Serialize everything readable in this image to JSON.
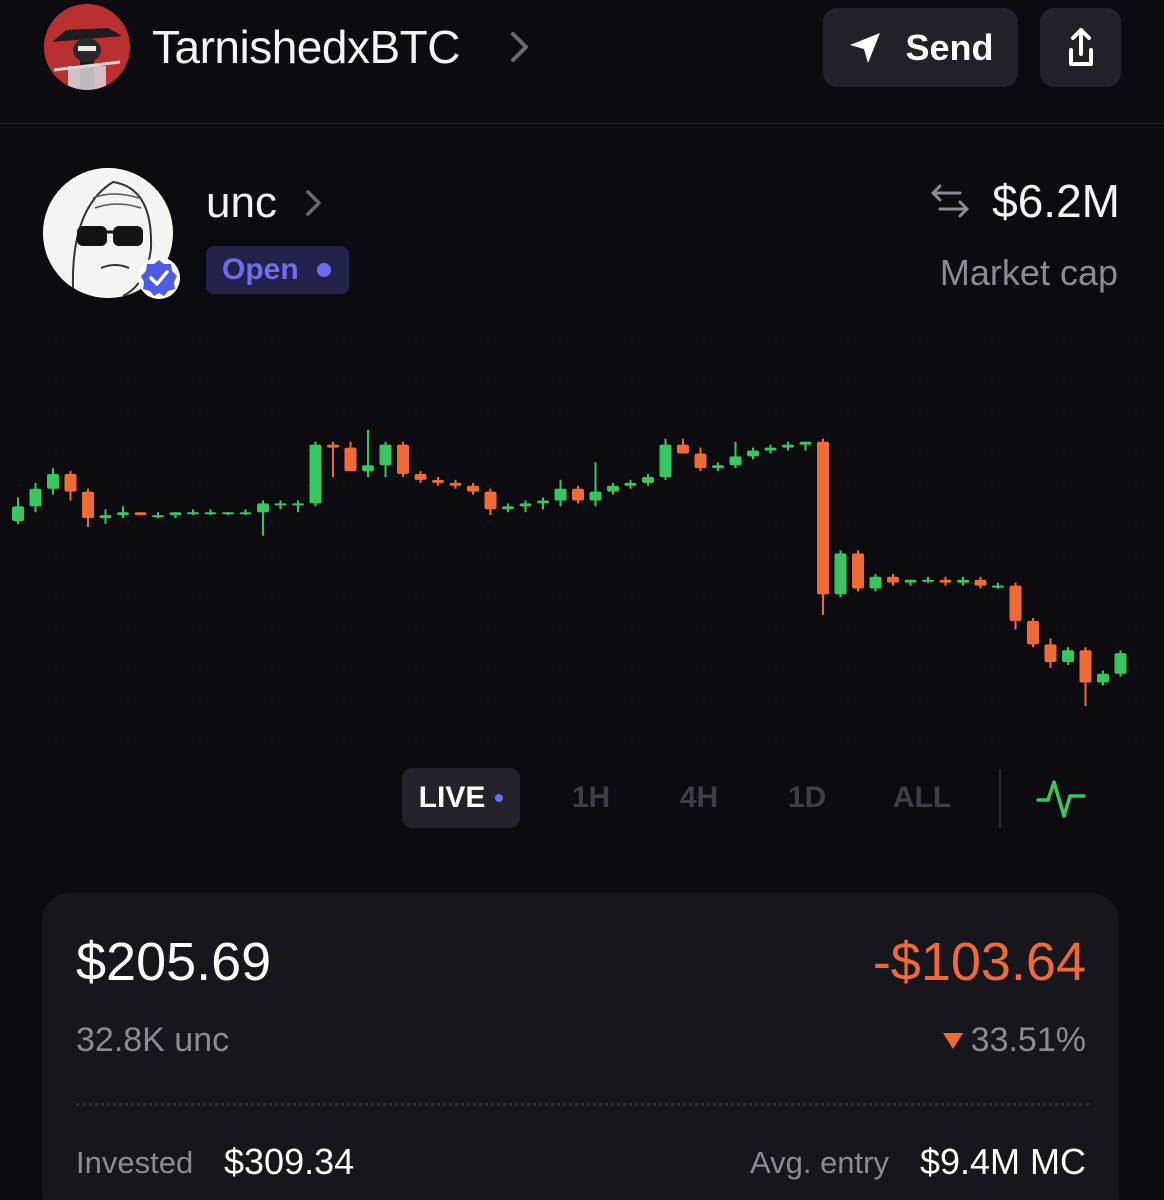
{
  "header": {
    "user_name": "TarnishedxBTC",
    "send_label": "Send"
  },
  "token": {
    "name": "unc",
    "status": "Open",
    "market_cap_value": "$6.2M",
    "market_cap_label": "Market cap"
  },
  "timeframes": [
    {
      "label": "LIVE",
      "active": true
    },
    {
      "label": "1H",
      "active": false
    },
    {
      "label": "4H",
      "active": false
    },
    {
      "label": "1D",
      "active": false
    },
    {
      "label": "ALL",
      "active": false
    }
  ],
  "position": {
    "value": "$205.69",
    "amount": "32.8K unc",
    "pnl": "-$103.64",
    "pnl_pct": "33.51%",
    "invested_label": "Invested",
    "invested_value": "$309.34",
    "entry_label": "Avg. entry",
    "entry_value": "$9.4M MC"
  },
  "colors": {
    "up": "#37c75e",
    "down": "#f06a35",
    "accent": "#6e6cf0",
    "background": "#0c0b10",
    "card": "#17161d"
  },
  "icons": {
    "send": "paper-plane-icon",
    "share": "share-icon",
    "market_cap": "swap-arrows-icon",
    "chart_style": "pulse-line-icon",
    "verified": "verified-check-icon"
  },
  "chart_data": {
    "type": "candlestick",
    "ohlc": [
      [
        5.35,
        5.43,
        5.34,
        5.4
      ],
      [
        5.4,
        5.48,
        5.38,
        5.46
      ],
      [
        5.46,
        5.53,
        5.44,
        5.51
      ],
      [
        5.51,
        5.52,
        5.42,
        5.45
      ],
      [
        5.45,
        5.46,
        5.33,
        5.36
      ],
      [
        5.36,
        5.39,
        5.34,
        5.37
      ],
      [
        5.37,
        5.4,
        5.36,
        5.38
      ],
      [
        5.38,
        5.38,
        5.37,
        5.37
      ],
      [
        5.37,
        5.38,
        5.36,
        5.37
      ],
      [
        5.37,
        5.38,
        5.36,
        5.38
      ],
      [
        5.38,
        5.39,
        5.37,
        5.38
      ],
      [
        5.38,
        5.39,
        5.37,
        5.38
      ],
      [
        5.38,
        5.38,
        5.37,
        5.38
      ],
      [
        5.38,
        5.39,
        5.37,
        5.38
      ],
      [
        5.38,
        5.42,
        5.3,
        5.41
      ],
      [
        5.41,
        5.42,
        5.39,
        5.41
      ],
      [
        5.41,
        5.42,
        5.38,
        5.41
      ],
      [
        5.41,
        5.62,
        5.4,
        5.61
      ],
      [
        5.61,
        5.62,
        5.5,
        5.6
      ],
      [
        5.6,
        5.62,
        5.58,
        5.52
      ],
      [
        5.52,
        5.66,
        5.5,
        5.54
      ],
      [
        5.54,
        5.62,
        5.5,
        5.61
      ],
      [
        5.61,
        5.62,
        5.5,
        5.51
      ],
      [
        5.51,
        5.52,
        5.48,
        5.49
      ],
      [
        5.49,
        5.5,
        5.47,
        5.48
      ],
      [
        5.48,
        5.49,
        5.46,
        5.47
      ],
      [
        5.47,
        5.48,
        5.44,
        5.45
      ],
      [
        5.45,
        5.46,
        5.37,
        5.39
      ],
      [
        5.39,
        5.41,
        5.38,
        5.4
      ],
      [
        5.4,
        5.42,
        5.38,
        5.41
      ],
      [
        5.41,
        5.43,
        5.39,
        5.42
      ],
      [
        5.42,
        5.49,
        5.4,
        5.46
      ],
      [
        5.46,
        5.47,
        5.41,
        5.42
      ],
      [
        5.42,
        5.55,
        5.4,
        5.45
      ],
      [
        5.45,
        5.48,
        5.44,
        5.47
      ],
      [
        5.47,
        5.49,
        5.46,
        5.48
      ],
      [
        5.48,
        5.51,
        5.47,
        5.5
      ],
      [
        5.5,
        5.63,
        5.49,
        5.61
      ],
      [
        5.61,
        5.63,
        5.58,
        5.58
      ],
      [
        5.58,
        5.6,
        5.52,
        5.53
      ],
      [
        5.53,
        5.55,
        5.52,
        5.54
      ],
      [
        5.54,
        5.62,
        5.53,
        5.57
      ],
      [
        5.57,
        5.6,
        5.56,
        5.59
      ],
      [
        5.59,
        5.61,
        5.58,
        5.6
      ],
      [
        5.6,
        5.62,
        5.59,
        5.61
      ],
      [
        5.61,
        5.62,
        5.59,
        5.62
      ],
      [
        5.62,
        5.63,
        5.03,
        5.1
      ],
      [
        5.1,
        5.25,
        5.09,
        5.24
      ],
      [
        5.24,
        5.25,
        5.11,
        5.12
      ],
      [
        5.12,
        5.17,
        5.11,
        5.16
      ],
      [
        5.16,
        5.17,
        5.13,
        5.14
      ],
      [
        5.14,
        5.15,
        5.13,
        5.15
      ],
      [
        5.15,
        5.16,
        5.14,
        5.15
      ],
      [
        5.15,
        5.16,
        5.13,
        5.14
      ],
      [
        5.14,
        5.16,
        5.13,
        5.15
      ],
      [
        5.15,
        5.16,
        5.12,
        5.13
      ],
      [
        5.13,
        5.14,
        5.12,
        5.13
      ],
      [
        5.13,
        5.14,
        4.98,
        5.01
      ],
      [
        5.01,
        5.02,
        4.92,
        4.93
      ],
      [
        4.93,
        4.95,
        4.85,
        4.87
      ],
      [
        4.87,
        4.92,
        4.86,
        4.91
      ],
      [
        4.91,
        4.92,
        4.72,
        4.8
      ],
      [
        4.8,
        4.84,
        4.79,
        4.83
      ],
      [
        4.83,
        4.91,
        4.82,
        4.9
      ]
    ]
  }
}
